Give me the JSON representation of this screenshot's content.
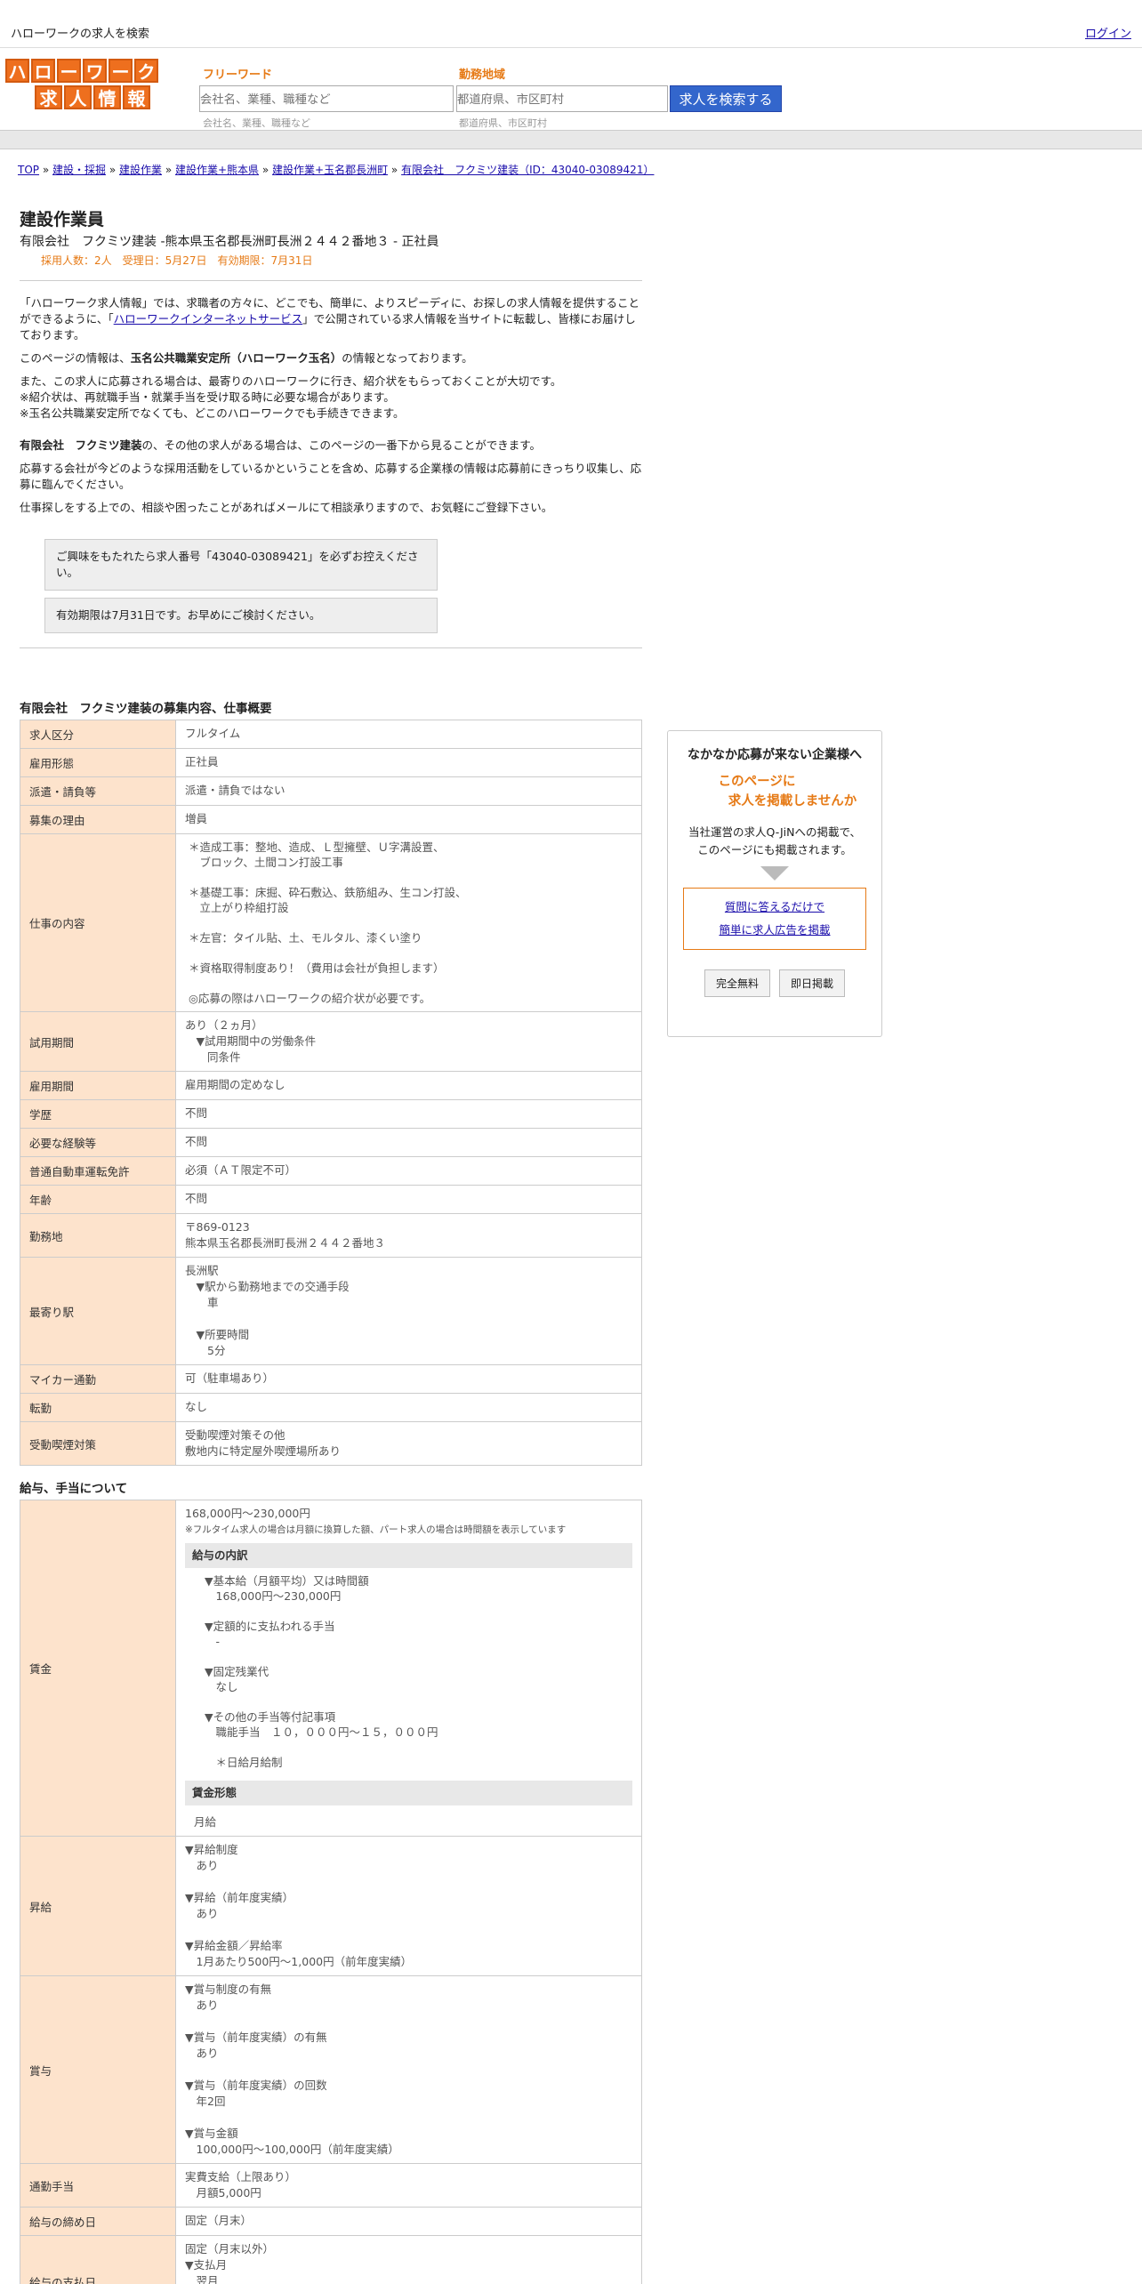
{
  "top": {
    "title": "ハローワークの求人を検索",
    "login": "ログイン"
  },
  "header": {
    "logo_row1": [
      "ハ",
      "ロ",
      "ー",
      "ワ",
      "ー",
      "ク"
    ],
    "logo_row2": [
      "求",
      "人",
      "情",
      "報"
    ],
    "free_label": "フリーワード",
    "free_placeholder": "会社名、業種、職種など",
    "area_label": "勤務地域",
    "area_placeholder": "都道府県、市区町村",
    "search_button": "求人を検索する"
  },
  "breadcrumb": [
    "TOP",
    "建設・採掘",
    "建設作業",
    "建設作業+熊本県",
    "建設作業+玉名郡長洲町",
    "有限会社　フクミツ建装（ID：43040-03089421）"
  ],
  "job": {
    "title": "建設作業員",
    "subtitle": "有限会社　フクミツ建装 -熊本県玉名郡長洲町長洲２４４２番地３ - 正社員",
    "meta": "採用人数：2人　受理日：5月27日　有効期限：7月31日"
  },
  "intro": {
    "p1a": "「ハローワーク求人情報」では、求職者の方々に、どこでも、簡単に、よりスピーディに、お探しの求人情報を提供することができるように、「",
    "p1link": "ハローワークインターネットサービス",
    "p1b": "」で公開されている求人情報を当サイトに転載し、皆様にお届けしております。",
    "p2a": "このページの情報は、",
    "p2b": "玉名公共職業安定所（ハローワーク玉名）",
    "p2c": "の情報となっております。",
    "p3a": "また、この求人に応募される場合は、最寄りのハローワークに行き、紹介状をもらっておくことが大切です。",
    "p3b": "※紹介状は、再就職手当・就業手当を受け取る時に必要な場合があります。",
    "p3c": "※玉名公共職業安定所でなくても、どこのハローワークでも手続きできます。",
    "p4a": "有限会社　フクミツ建装",
    "p4b": "の、その他の求人がある場合は、このページの一番下から見ることができます。",
    "p5": "応募する会社が今どのような採用活動をしているかということを含め、応募する企業様の情報は応募前にきっちり収集し、応募に臨んでください。",
    "p6": "仕事探しをする上での、相談や困ったことがあればメールにて相談承りますので、お気軽にご登録下さい。",
    "notice1": "ご興味をもたれたら求人番号「43040-03089421」を必ずお控えください。",
    "notice2": "有効期限は7月31日です。お早めにご検討ください。"
  },
  "overview": {
    "title": "有限会社　フクミツ建装の募集内容、仕事概要",
    "rows": [
      [
        "求人区分",
        "フルタイム"
      ],
      [
        "雇用形態",
        "正社員"
      ],
      [
        "派遣・請負等",
        "派遣・請負ではない"
      ],
      [
        "募集の理由",
        "増員"
      ],
      [
        "仕事の内容",
        "＊造成工事：整地、造成、Ｌ型擁壁、Ｕ字溝設置、\n　ブロック、土間コン打設工事\n\n＊基礎工事：床掘、砕石敷込、鉄筋組み、生コン打設、\n　立上がり枠組打設\n\n＊左官：タイル貼、土、モルタル、漆くい塗り\n\n＊資格取得制度あり！（費用は会社が負担します）\n\n◎応募の際はハローワークの紹介状が必要です。"
      ],
      [
        "試用期間",
        "あり（２ヵ月）\n　▼試用期間中の労働条件\n　　同条件"
      ],
      [
        "雇用期間",
        "雇用期間の定めなし"
      ],
      [
        "学歴",
        "不問"
      ],
      [
        "必要な経験等",
        "不問"
      ],
      [
        "普通自動車運転免許",
        "必須（ＡＴ限定不可）"
      ],
      [
        "年齢",
        "不問"
      ],
      [
        "勤務地",
        "〒869-0123\n熊本県玉名郡長洲町長洲２４４２番地３"
      ],
      [
        "最寄り駅",
        "長洲駅\n　▼駅から勤務地までの交通手段\n　　車\n\n　▼所要時間\n　　5分"
      ],
      [
        "マイカー通勤",
        "可（駐車場あり）"
      ],
      [
        "転勤",
        "なし"
      ],
      [
        "受動喫煙対策",
        "受動喫煙対策その他\n敷地内に特定屋外喫煙場所あり"
      ]
    ]
  },
  "salary": {
    "title": "給与、手当について",
    "wage_label": "賃金",
    "wage_range": "168,000円〜230,000円",
    "wage_note": "※フルタイム求人の場合は月額に換算した額、パート求人の場合は時間額を表示しています",
    "breakdown_title": "給与の内訳",
    "breakdown": "▼基本給（月額平均）又は時間額\n　168,000円〜230,000円\n\n▼定額的に支払われる手当\n　-\n\n▼固定残業代\n　なし\n\n▼その他の手当等付記事項\n　職能手当　１０，０００円～１５，０００円\n\n　＊日給月給制",
    "form_title": "賃金形態",
    "form_value": "月給",
    "rows": [
      [
        "昇給",
        "▼昇給制度\n　あり\n\n▼昇給（前年度実績）\n　あり\n\n▼昇給金額／昇給率\n　1月あたり500円〜1,000円（前年度実績）"
      ],
      [
        "賞与",
        "▼賞与制度の有無\n　あり\n\n▼賞与（前年度実績）の有無\n　あり\n\n▼賞与（前年度実績）の回数\n　年2回\n\n▼賞与金額\n　100,000円〜100,000円（前年度実績）"
      ],
      [
        "通勤手当",
        "実費支給（上限あり）\n　月額5,000円"
      ],
      [
        "給与の締め日",
        "固定（月末）"
      ],
      [
        "給与の支払日",
        "固定（月末以外）\n▼支払月\n　翌月\n\n▼支払日"
      ]
    ]
  },
  "side": {
    "heading": "なかなか応募が来ない企業様へ",
    "highlight1": "このページに",
    "highlight2": "求人を掲載しませんか",
    "text1": "当社運営の求人Q-JiNへの掲載で、",
    "text2": "このページにも掲載されます。",
    "link1": "質問に答えるだけで",
    "link2": "簡単に求人広告を掲載",
    "btn1": "完全無料",
    "btn2": "即日掲載"
  }
}
